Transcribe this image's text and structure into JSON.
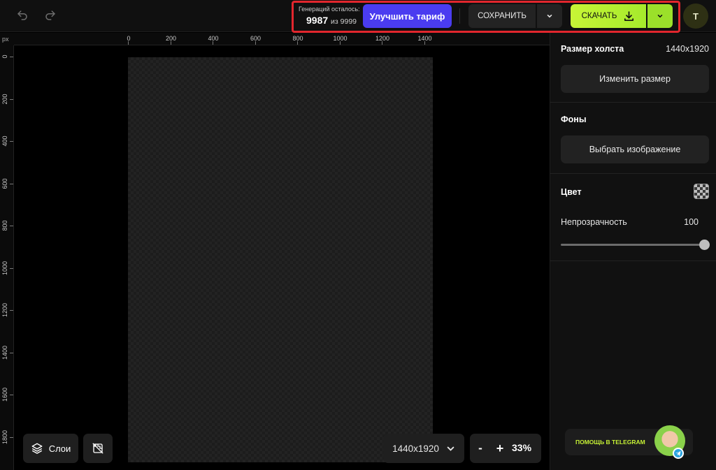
{
  "toolbar": {
    "undo_icon": "undo-icon",
    "redo_icon": "redo-icon",
    "generations_label": "Генераций осталось:",
    "generations_left": "9987",
    "generations_total_text": "из 9999",
    "upgrade_label": "Улучшить тариф",
    "save_label": "СОХРАНИТЬ",
    "download_label": "СКАЧАТЬ",
    "avatar_initial": "T",
    "accent_green": "#b8f032",
    "accent_purple": "#4a3cf0"
  },
  "ruler": {
    "unit": "px",
    "horizontal_ticks": [
      "0",
      "200",
      "400",
      "600",
      "800",
      "1000",
      "1200",
      "1400"
    ],
    "vertical_ticks": [
      "0",
      "200",
      "400",
      "600",
      "800",
      "1000",
      "1200",
      "1400",
      "1600",
      "1800"
    ]
  },
  "bottom_bar": {
    "layers_label": "Слои",
    "canvas_size": "1440x1920",
    "zoom_minus": "-",
    "zoom_plus": "+",
    "zoom_value": "33%"
  },
  "panel": {
    "canvas_size_title": "Размер холста",
    "canvas_size_value": "1440x1920",
    "resize_label": "Изменить размер",
    "backgrounds_title": "Фоны",
    "choose_image_label": "Выбрать изображение",
    "color_title": "Цвет",
    "opacity_label": "Непрозрачность",
    "opacity_value": "100",
    "opacity_fraction": 1.0
  },
  "help": {
    "telegram_label": "ПОМОЩЬ В TELEGRAM"
  }
}
